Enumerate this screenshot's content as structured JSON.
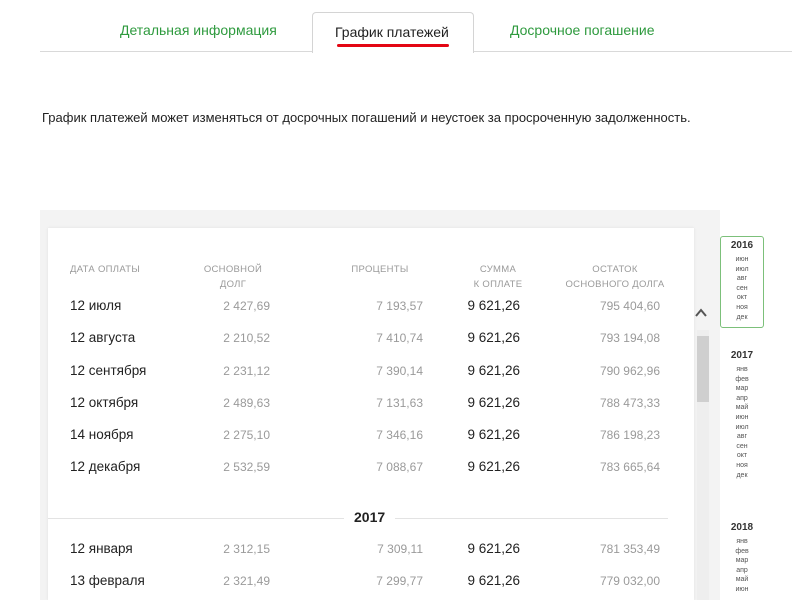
{
  "tabs": [
    {
      "label": "Детальная информация",
      "active": false
    },
    {
      "label": "График платежей",
      "active": true
    },
    {
      "label": "Досрочное погашение",
      "active": false
    }
  ],
  "note": "График платежей может изменяться от досрочных погашений и неустоек за просроченную задолженность.",
  "table": {
    "headers": {
      "date": "ДАТА ОПЛАТЫ",
      "principal_1": "ОСНОВНОЙ",
      "principal_2": "ДОЛГ",
      "interest": "ПРОЦЕНТЫ",
      "total_1": "СУММА",
      "total_2": "К ОПЛАТЕ",
      "balance_1": "ОСТАТОК",
      "balance_2": "ОСНОВНОГО ДОЛГА"
    },
    "rows": [
      {
        "date": "12 июля",
        "principal": "2 427,69",
        "interest": "7 193,57",
        "total": "9 621,26",
        "balance": "795 404,60"
      },
      {
        "date": "12 августа",
        "principal": "2 210,52",
        "interest": "7 410,74",
        "total": "9 621,26",
        "balance": "793 194,08"
      },
      {
        "date": "12 сентября",
        "principal": "2 231,12",
        "interest": "7 390,14",
        "total": "9 621,26",
        "balance": "790 962,96"
      },
      {
        "date": "12 октября",
        "principal": "2 489,63",
        "interest": "7 131,63",
        "total": "9 621,26",
        "balance": "788 473,33"
      },
      {
        "date": "14 ноября",
        "principal": "2 275,10",
        "interest": "7 346,16",
        "total": "9 621,26",
        "balance": "786 198,23"
      },
      {
        "date": "12 декабря",
        "principal": "2 532,59",
        "interest": "7 088,67",
        "total": "9 621,26",
        "balance": "783 665,64"
      }
    ],
    "year_separator": "2017",
    "rows_next": [
      {
        "date": "12 января",
        "principal": "2 312,15",
        "interest": "7 309,11",
        "total": "9 621,26",
        "balance": "781 353,49"
      },
      {
        "date": "13 февраля",
        "principal": "2 321,49",
        "interest": "7 299,77",
        "total": "9 621,26",
        "balance": "779 032,00"
      }
    ]
  },
  "timeline": {
    "years": [
      {
        "year": "2016",
        "months": [
          "июн",
          "июл",
          "авг",
          "сен",
          "окт",
          "ноя",
          "дек"
        ]
      },
      {
        "year": "2017",
        "months": [
          "янв",
          "фев",
          "мар",
          "апр",
          "май",
          "июн",
          "июл",
          "авг",
          "сен",
          "окт",
          "ноя",
          "дек"
        ]
      },
      {
        "year": "2018",
        "months": [
          "янв",
          "фев",
          "мар",
          "апр",
          "май",
          "июн"
        ]
      }
    ]
  },
  "colors": {
    "accent_green": "#2e9a3e",
    "active_underline": "#e30613",
    "highlight_border": "#7cc07a"
  }
}
